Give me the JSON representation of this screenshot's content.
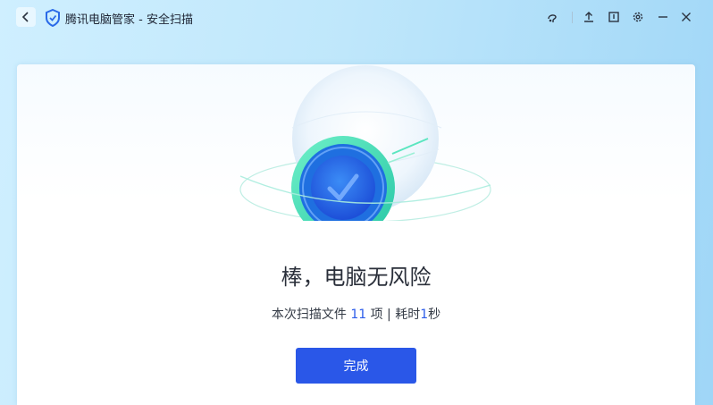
{
  "window": {
    "title": "腾讯电脑管家 - 安全扫描"
  },
  "titlebar_icons": [
    "skin-icon",
    "upload-icon",
    "feedback-icon",
    "settings-icon",
    "minimize-icon",
    "close-icon"
  ],
  "result": {
    "headline": "棒，电脑无风险",
    "summary_prefix": "本次扫描文件 ",
    "files_scanned": "11",
    "summary_middle": " 项 | 耗时",
    "duration": "1",
    "summary_suffix": "秒"
  },
  "actions": {
    "done_label": "完成"
  },
  "colors": {
    "accent": "#2a57e8",
    "number": "#2b5bea",
    "shield_green": "#3fe0b6"
  }
}
